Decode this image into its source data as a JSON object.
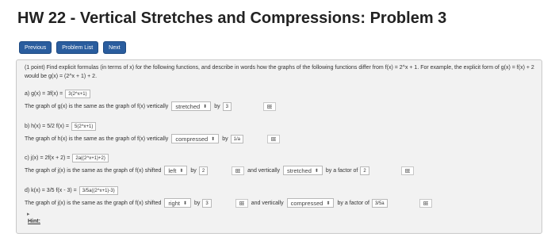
{
  "page": {
    "title": "HW 22 - Vertical Stretches and Compressions: Problem 3"
  },
  "nav": {
    "previous": "Previous",
    "problem_list": "Problem List",
    "next": "Next"
  },
  "intro": "(1 point) Find explicit formulas (in terms of x) for the following functions, and describe in words how the graphs of the following functions differ from f(x) = 2^x + 1. For example, the explicit form of g(x) = f(x) + 2 would be g(x) = (2^x + 1) + 2.",
  "a": {
    "formula": "a) g(x) = 3f(x) =",
    "answer": "3(2^x+1)",
    "text": "The graph of g(x) is the same as the graph of f(x) vertically",
    "select": "stretched",
    "by": "by",
    "factor": "3"
  },
  "b": {
    "formula": "b) h(x) = 5/2 f(x) =",
    "answer": "5(2^x+1)",
    "text": "The graph of h(x) is the same as the graph of f(x) vertically",
    "select": "compressed",
    "by": "by",
    "factor": "1/a"
  },
  "c": {
    "formula": "c) j(x) = 2f(x + 2) =",
    "answer": "2a((2^x+1)+2)",
    "text": "The graph of j(x) is the same as the graph of f(x) shifted",
    "select1": "left",
    "by": "by",
    "factor1": "2",
    "and_vert": "and vertically",
    "select2": "stretched",
    "by_factor": "by a factor of",
    "factor2": "2"
  },
  "d": {
    "formula": "d) k(x) = 3/5 f(x - 3) =",
    "answer": "3/5a((2^x+1)-3)",
    "text": "The graph of j(x) is the same as the graph of f(x) shifted",
    "select1": "right",
    "by": "by",
    "factor1": "3",
    "and_vert": "and vertically",
    "select2": "compressed",
    "by_factor": "by a factor of",
    "factor2": "3/5a"
  },
  "hint": "Hint:"
}
